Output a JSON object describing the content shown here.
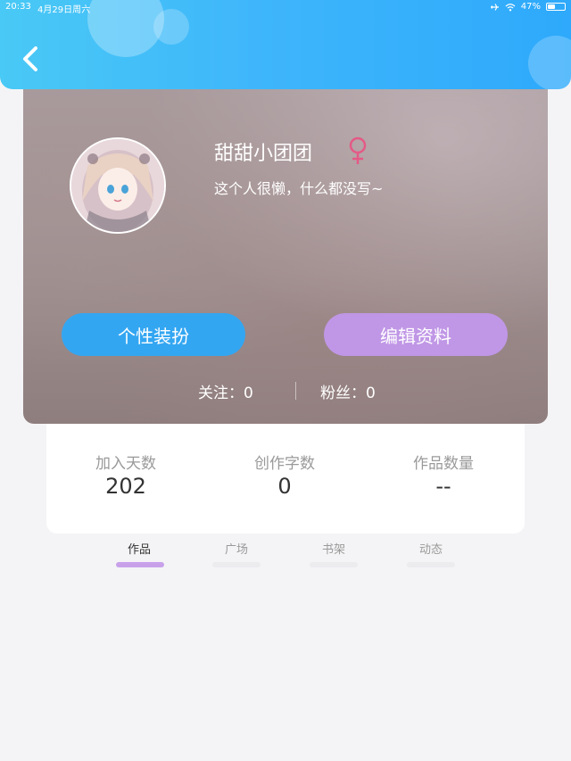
{
  "status_bar": {
    "time": "20:33",
    "date": "4月29日周六",
    "battery": "47%",
    "battery_level": 0.47
  },
  "profile": {
    "username": "甜甜小团团",
    "gender_icon": "female-symbol-icon",
    "bio": "这个人很懒，什么都没写~",
    "dress_button": "个性装扮",
    "edit_button": "编辑资料",
    "follow_label": "关注：0",
    "fans_label": "粉丝：0"
  },
  "stats": [
    {
      "label": "加入天数",
      "value": "202"
    },
    {
      "label": "创作字数",
      "value": "0"
    },
    {
      "label": "作品数量",
      "value": "--"
    }
  ],
  "tabs": [
    {
      "label": "作品",
      "active": true
    },
    {
      "label": "广场",
      "active": false
    },
    {
      "label": "书架",
      "active": false
    },
    {
      "label": "动态",
      "active": false
    }
  ],
  "colors": {
    "header_blue": "#3fb6fb",
    "dress_button": "#33a6f2",
    "edit_button": "#c097e6",
    "female_symbol": "#e45a86",
    "tab_indicator_active": "#c8a1ea"
  }
}
